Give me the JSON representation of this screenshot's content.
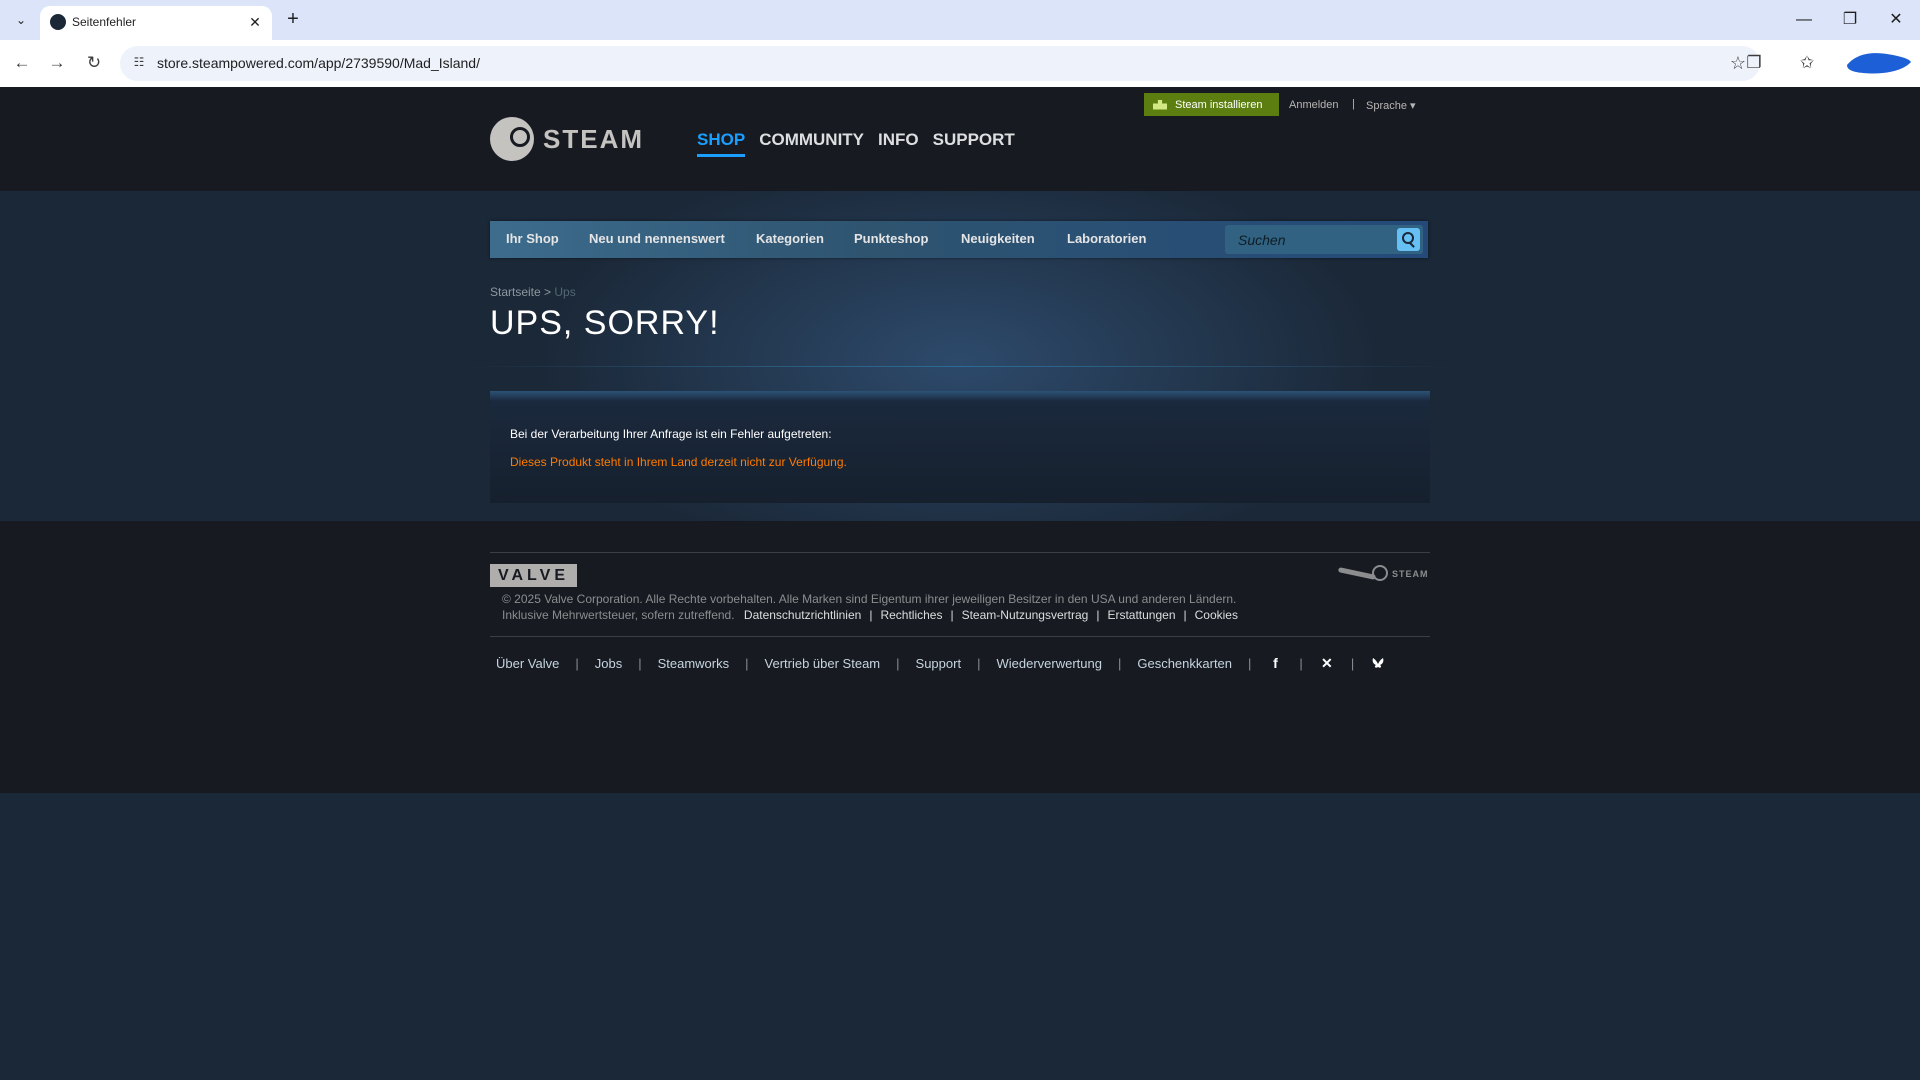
{
  "browser": {
    "tab_title": "Seitenfehler",
    "url": "store.steampowered.com/app/2739590/Mad_Island/"
  },
  "steam": {
    "install_label": "Steam installieren",
    "login_label": "Anmelden",
    "top_sep": "|",
    "language_label": "Sprache ▾",
    "logo_text": "STEAM",
    "main_nav": [
      "SHOP",
      "COMMUNITY",
      "INFO",
      "SUPPORT"
    ],
    "store_nav": [
      "Ihr Shop",
      "Neu und nennenswert",
      "Kategorien",
      "Punkteshop",
      "Neuigkeiten",
      "Laboratorien"
    ],
    "search_placeholder": "Suchen",
    "breadcrumb_home": "Startseite",
    "breadcrumb_sep": " > ",
    "breadcrumb_current": "Ups",
    "page_title": "UPS, SORRY!",
    "error_intro": "Bei der Verarbeitung Ihrer Anfrage ist ein Fehler aufgetreten:",
    "error_message": "Dieses Produkt steht in Ihrem Land derzeit nicht zur Verfügung."
  },
  "footer": {
    "valve_logo": "VALVE",
    "steam_logo": "STEAM",
    "copyright": "© 2025 Valve Corporation. Alle Rechte vorbehalten. Alle Marken sind Eigentum ihrer jeweiligen Besitzer in den USA und anderen Ländern.",
    "vat_note": "Inklusive Mehrwertsteuer, sofern zutreffend.",
    "legal_links": [
      "Datenschutzrichtlinien",
      "Rechtliches",
      "Steam-Nutzungsvertrag",
      "Erstattungen",
      "Cookies"
    ],
    "links": [
      "Über Valve",
      "Jobs",
      "Steamworks",
      "Vertrieb über Steam",
      "Support",
      "Wiederverwertung",
      "Geschenkkarten"
    ],
    "social_icons": [
      "facebook-icon",
      "x-icon",
      "bluesky-icon"
    ]
  },
  "colors": {
    "accent_blue": "#1a9fff",
    "error_orange": "#ff7b00",
    "install_green": "#5c7e10",
    "page_bg": "#1b2838"
  }
}
